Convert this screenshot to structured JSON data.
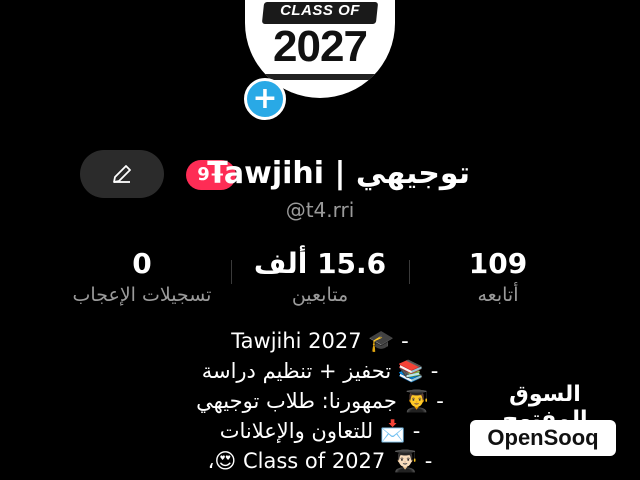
{
  "profile": {
    "avatar_text_top": "CLASS OF",
    "avatar_text_year": "2027",
    "add_symbol": "+",
    "badge": "9+",
    "display_name": "توجيهي | Tawjihi",
    "handle": "@t4.rri"
  },
  "stats": [
    {
      "value": "109",
      "label": "أتابعه"
    },
    {
      "value": "15.6 ألف",
      "label": "متابعين"
    },
    {
      "value": "0",
      "label": "تسجيلات الإعجاب"
    }
  ],
  "bio": [
    "- 🎓 Tawjihi 2027",
    "- 📚 تحفيز + تنظيم دراسة",
    "- 👨‍🎓 جمهورنا: طلاب توجيهي",
    "- 📩 للتعاون والإعلانات",
    "- 👨🏻‍🎓 Class of 2027 😍،"
  ],
  "watermark": {
    "arabic": "السوق المفتوح",
    "latin": "OpenSooq"
  },
  "colors": {
    "background": "#000000",
    "badge": "#fe2c55",
    "add_button": "#29a9e6",
    "edit_button": "#2b2b2b",
    "muted_text": "#9a9a9a"
  },
  "icons": {
    "edit": "pencil-icon"
  }
}
